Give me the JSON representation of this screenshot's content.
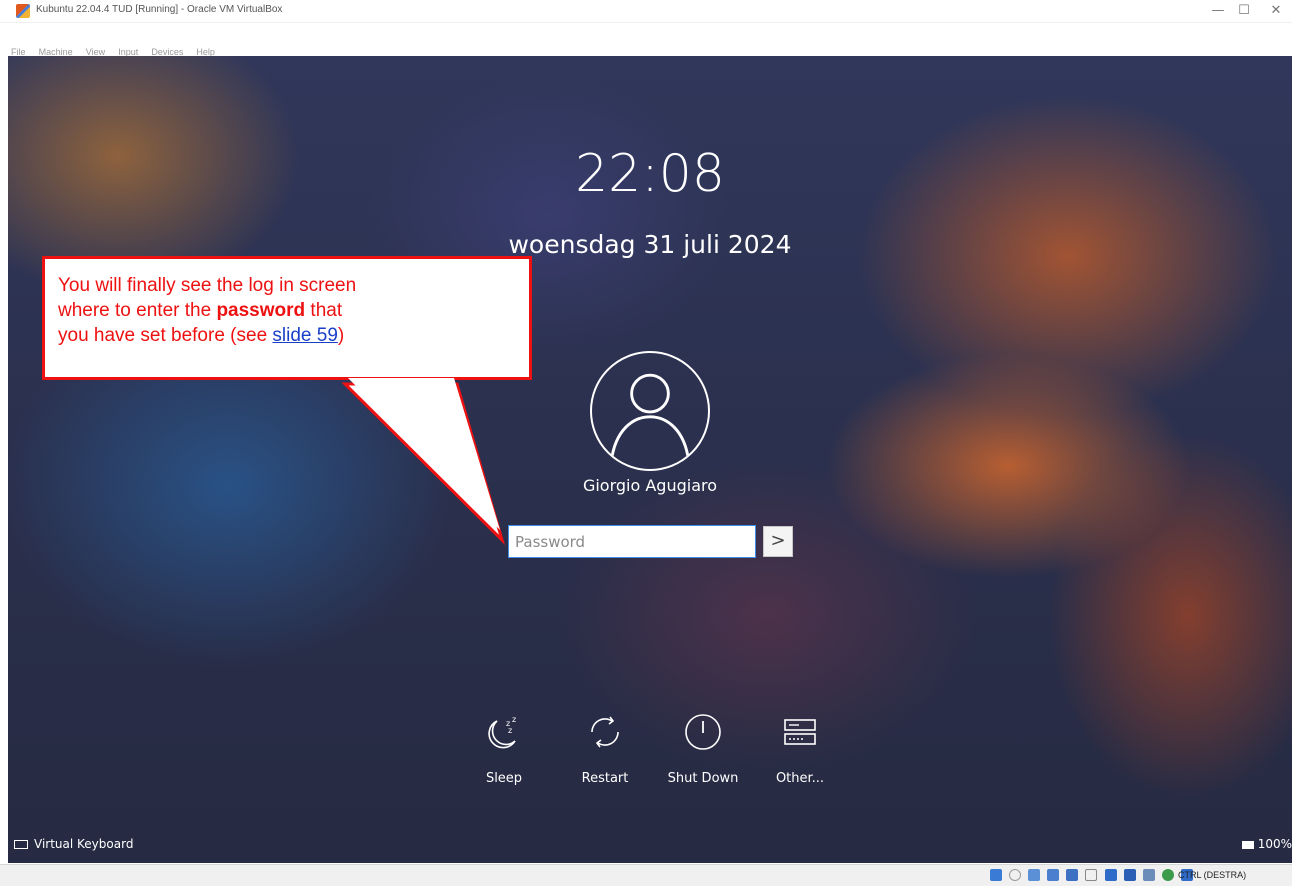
{
  "window": {
    "title": "Kubuntu 22.04.4 TUD [Running] - Oracle VM VirtualBox",
    "minimize_glyph": "—",
    "maximize_glyph": "☐",
    "close_glyph": "✕"
  },
  "menubar": {
    "items": [
      "File",
      "Machine",
      "View",
      "Input",
      "Devices",
      "Help"
    ]
  },
  "lockscreen": {
    "time": "22:08",
    "date": "woensdag 31 juli 2024",
    "user_name": "Giorgio Agugiaro",
    "password_placeholder": "Password",
    "password_value": "",
    "submit_glyph": ">",
    "actions": [
      {
        "label": "Sleep",
        "icon": "sleep-icon"
      },
      {
        "label": "Restart",
        "icon": "restart-icon"
      },
      {
        "label": "Shut Down",
        "icon": "shutdown-icon"
      },
      {
        "label": "Other...",
        "icon": "switch-user-icon"
      }
    ],
    "virtual_keyboard_label": "Virtual Keyboard",
    "battery_label": "100%"
  },
  "callout": {
    "line1": "You will finally see the log in screen",
    "line2_prefix": "where to enter the ",
    "line2_bold": "password",
    "line2_suffix": " that",
    "line3_prefix": "you have set before (see ",
    "line3_link": "slide 59",
    "line3_suffix": ")",
    "text_color": "#ee1111",
    "border_color": "#ee1111",
    "link_color": "#1a3fc9"
  },
  "statusbar": {
    "host_key": "CTRL (DESTRA)",
    "icons": [
      "hard-disk-icon",
      "optical-drive-icon",
      "audio-icon",
      "network-icon",
      "usb-icon",
      "shared-folders-icon",
      "display-icon",
      "video-capture-icon",
      "cpu-icon",
      "network-activity-icon",
      "mouse-integration-icon"
    ]
  }
}
